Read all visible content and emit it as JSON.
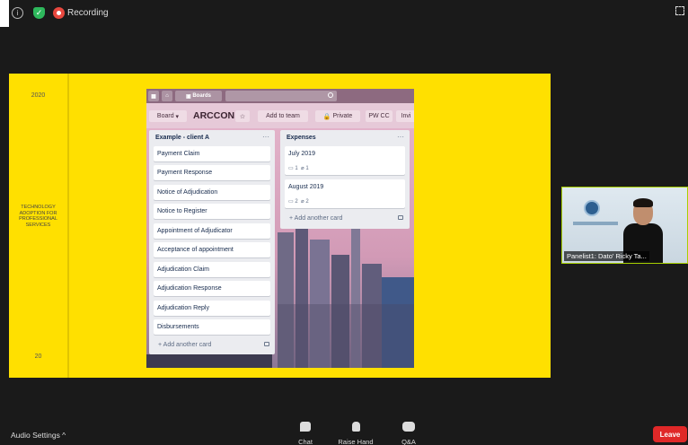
{
  "status_bar": {
    "info_glyph": "i",
    "recording_label": "Recording"
  },
  "slide": {
    "year": "2020",
    "topic": "TECHNOLOGY ADOPTION FOR PROFESSIONAL SERVICES",
    "page_number": "20"
  },
  "trello": {
    "boards_label": "Boards",
    "board_switcher": "Board",
    "board_title": "ARCCON",
    "add_to_team": "Add to team",
    "privacy": "Private",
    "member_initials": "PW",
    "member_initials_2": "CC",
    "invite": "Invi",
    "lists": [
      {
        "title": "Example - client A",
        "menu": "···",
        "cards": [
          "Payment Claim",
          "Payment Response",
          "Notice of Adjudication",
          "Notice to Register",
          "Appointment of Adjudicator",
          "Acceptance of appointment",
          "Adjudication Claim",
          "Adjudication Response",
          "Adjudication Reply",
          "Disbursements"
        ],
        "add_card": "+ Add another card"
      },
      {
        "title": "Expenses",
        "menu": "···",
        "cards": [
          {
            "title": "July 2019",
            "comments": "1",
            "attachments": "1"
          },
          {
            "title": "August 2019",
            "comments": "2",
            "attachments": "2"
          }
        ],
        "add_card": "+ Add another card"
      }
    ]
  },
  "video": {
    "panelist_label": "Panelist1: Dato' Ricky Ta..."
  },
  "toolbar": {
    "audio_settings": "Audio Settings ^",
    "chat": "Chat",
    "raise_hand": "Raise Hand",
    "qa": "Q&A",
    "leave": "Leave"
  },
  "colors": {
    "slide_yellow": "#ffe000",
    "leave_red": "#e02828",
    "video_border": "#a8d000"
  }
}
